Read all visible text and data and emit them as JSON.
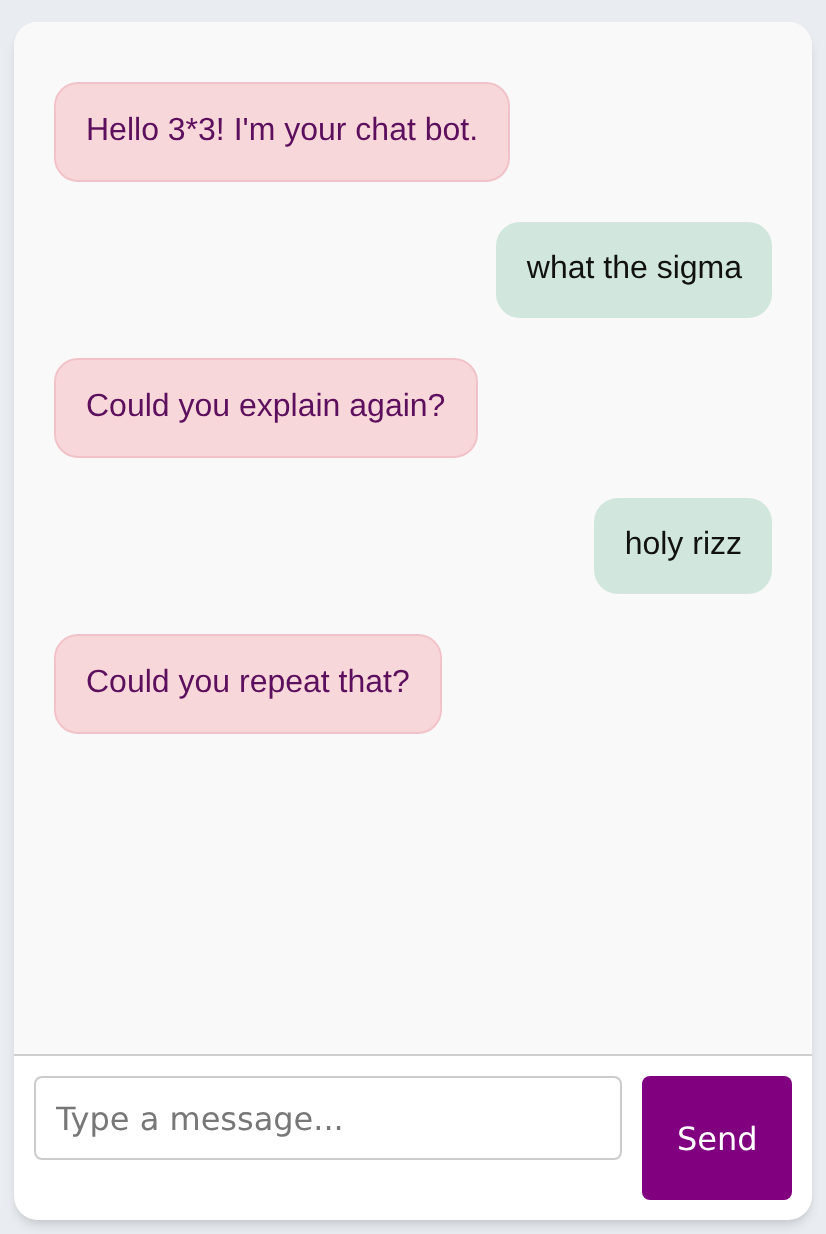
{
  "messages": [
    {
      "kind": "greeting",
      "text": "Hello 3*3! I'm your chat bot."
    },
    {
      "kind": "user",
      "text": "what the sigma"
    },
    {
      "kind": "bot",
      "text": "Could you explain again?"
    },
    {
      "kind": "user",
      "text": "holy rizz"
    },
    {
      "kind": "bot",
      "text": "Could you repeat that?"
    }
  ],
  "composer": {
    "placeholder": "Type a message...",
    "button": "Send"
  }
}
